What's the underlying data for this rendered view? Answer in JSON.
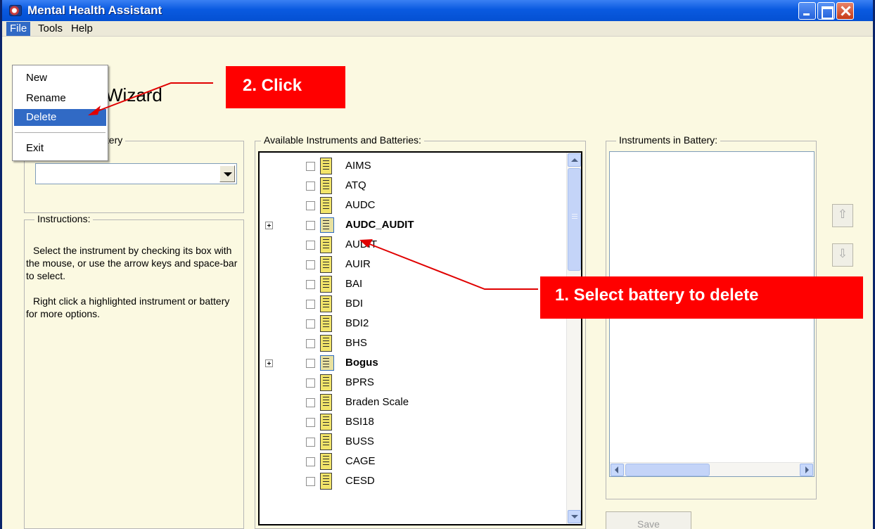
{
  "window": {
    "title": "Mental Health Assistant"
  },
  "menubar": {
    "file": "File",
    "tools": "Tools",
    "help": "Help"
  },
  "file_menu": {
    "new": "New",
    "rename": "Rename",
    "delete": "Delete",
    "exit": "Exit"
  },
  "header": {
    "title_fragment": "Wizard"
  },
  "battery_group": {
    "label_fragment": "ttery",
    "selected_value": ""
  },
  "instructions": {
    "label": "Instructions:",
    "para1": "Select the instrument by checking its box with the mouse, or use the arrow keys and space-bar to select.",
    "para2": "Right click a highlighted instrument or battery for more options."
  },
  "available": {
    "label": "Available Instruments and Batteries:",
    "items": [
      {
        "name": "AIMS",
        "battery": false
      },
      {
        "name": "ATQ",
        "battery": false
      },
      {
        "name": "AUDC",
        "battery": false
      },
      {
        "name": "AUDC_AUDIT",
        "battery": true
      },
      {
        "name": "AUDIT",
        "battery": false
      },
      {
        "name": "AUIR",
        "battery": false
      },
      {
        "name": "BAI",
        "battery": false
      },
      {
        "name": "BDI",
        "battery": false
      },
      {
        "name": "BDI2",
        "battery": false
      },
      {
        "name": "BHS",
        "battery": false
      },
      {
        "name": "Bogus",
        "battery": true
      },
      {
        "name": "BPRS",
        "battery": false
      },
      {
        "name": "Braden Scale",
        "battery": false
      },
      {
        "name": "BSI18",
        "battery": false
      },
      {
        "name": "BUSS",
        "battery": false
      },
      {
        "name": "CAGE",
        "battery": false
      },
      {
        "name": "CESD",
        "battery": false
      }
    ]
  },
  "in_battery": {
    "label": "Instruments in Battery:",
    "items": []
  },
  "buttons": {
    "save": "Save",
    "move_up_glyph": "⇧",
    "move_down_glyph": "⇩"
  },
  "annotations": {
    "click": "2. Click",
    "select": "1. Select battery to delete",
    "color": "#ff0000"
  }
}
